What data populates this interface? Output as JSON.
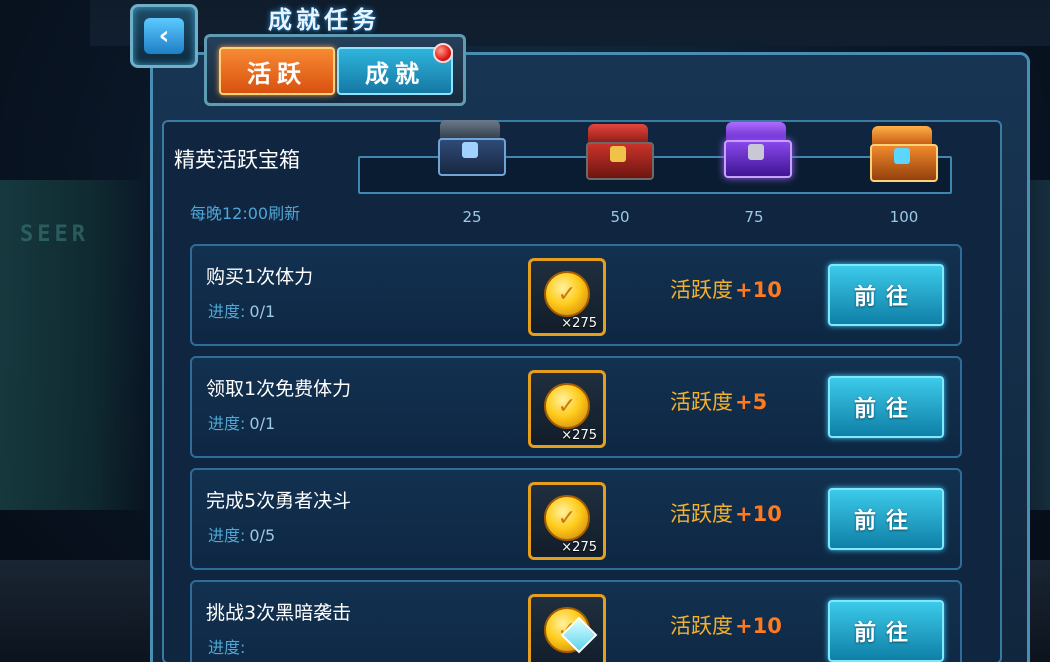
{
  "header": {
    "title": "成就任务",
    "back_icon": "chevron-left-icon"
  },
  "tabs": [
    {
      "label": "活跃",
      "active": true
    },
    {
      "label": "成就",
      "active": false,
      "has_notification": true
    }
  ],
  "activity_box": {
    "title": "精英活跃宝箱",
    "refresh_note": "每晚12:00刷新",
    "progress": 0.0,
    "milestones": [
      {
        "value": "25",
        "chest": "steel-chest-icon"
      },
      {
        "value": "50",
        "chest": "red-chest-icon"
      },
      {
        "value": "75",
        "chest": "purple-chest-icon"
      },
      {
        "value": "100",
        "chest": "orange-chest-icon"
      }
    ]
  },
  "tasks": [
    {
      "name": "购买1次体力",
      "progress_label": "进度:",
      "progress_value": "0/1",
      "reward_count": "×275",
      "points_label": "活跃度",
      "points_value": "+10",
      "button": "前往"
    },
    {
      "name": "领取1次免费体力",
      "progress_label": "进度:",
      "progress_value": "0/1",
      "reward_count": "×275",
      "points_label": "活跃度",
      "points_value": "+5",
      "button": "前往"
    },
    {
      "name": "完成5次勇者决斗",
      "progress_label": "进度:",
      "progress_value": "0/5",
      "reward_count": "×275",
      "points_label": "活跃度",
      "points_value": "+10",
      "button": "前往"
    },
    {
      "name": "挑战3次黑暗袭击",
      "progress_label": "进度:",
      "progress_value": "",
      "reward_count": "",
      "points_label": "活跃度",
      "points_value": "+10",
      "button": "前往"
    }
  ],
  "colors": {
    "accent_orange": "#d9510f",
    "accent_cyan": "#1578a4",
    "points_gold": "#f4b12a",
    "points_value": "#ff7a1f"
  }
}
